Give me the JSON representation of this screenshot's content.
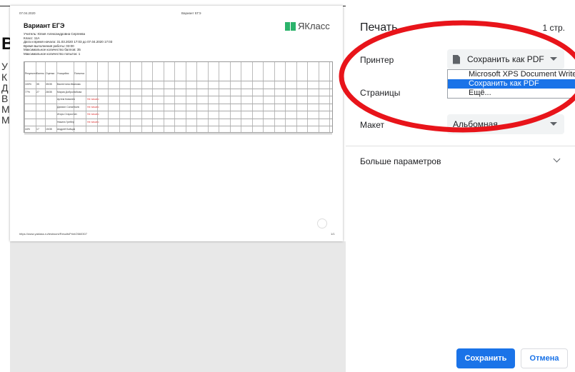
{
  "background_page": {
    "big_letter": "В",
    "letters": [
      "У",
      "К",
      "Д",
      "В",
      "М",
      "М"
    ]
  },
  "preview": {
    "date": "07.04.2020",
    "header": "Вариант ЕГЭ",
    "title": "Вариант ЕГЭ",
    "logo_text": "ЯКласс",
    "info": [
      "Учитель: Юлия Александровна Сергеева",
      "Класс: 11А",
      "Дата и время начала: 31.03.2020 17:03 до 07.04.2020 17:03",
      "Время выполнения работы: 03:00",
      "Максимальное количество баллов: 35",
      "Максимальное количество попыток: 1"
    ],
    "table_header": [
      "Результат",
      "Баллы",
      "Оценка",
      "Учащийся",
      "Попытка"
    ],
    "rows": [
      {
        "result": "100%",
        "score": "35",
        "grade": "35/35",
        "name": "Валентина Иванова"
      },
      {
        "result": "77%",
        "score": "27",
        "grade": "28/35",
        "name": "Мария Добролюбова"
      },
      {
        "result": "",
        "score": "",
        "grade": "",
        "name": "Артем Ковалев",
        "note": "Не начато"
      },
      {
        "result": "",
        "score": "",
        "grade": "",
        "name": "Даниил Силантьев",
        "note": "Не начато"
      },
      {
        "result": "",
        "score": "",
        "grade": "",
        "name": "Игорь Старостин",
        "note": "Не начато"
      },
      {
        "result": "",
        "score": "",
        "grade": "",
        "name": "Никита Гребер",
        "note": "Не начато"
      },
      {
        "result": "44%",
        "score": "17",
        "grade": "15/35",
        "name": "Андрей Бойцов"
      }
    ],
    "url": "https://www.yaklass.ru/testwork/ResultsPrint/2660307",
    "page_of": "1/1"
  },
  "panel": {
    "title": "Печать",
    "pages_count": "1 стр.",
    "printer_label": "Принтер",
    "printer_value": "Сохранить как PDF",
    "printer_options": [
      "Microsoft XPS Document Writer",
      "Сохранить как PDF",
      "Ещё..."
    ],
    "printer_selected_index": 1,
    "pages_label": "Страницы",
    "layout_label": "Макет",
    "layout_value": "Альбомная",
    "more_settings": "Больше параметров",
    "save_button": "Сохранить",
    "cancel_button": "Отмена"
  },
  "colors": {
    "accent": "#1a73e8",
    "annotation": "#e8141a",
    "logo_green": "#2bb36b"
  }
}
